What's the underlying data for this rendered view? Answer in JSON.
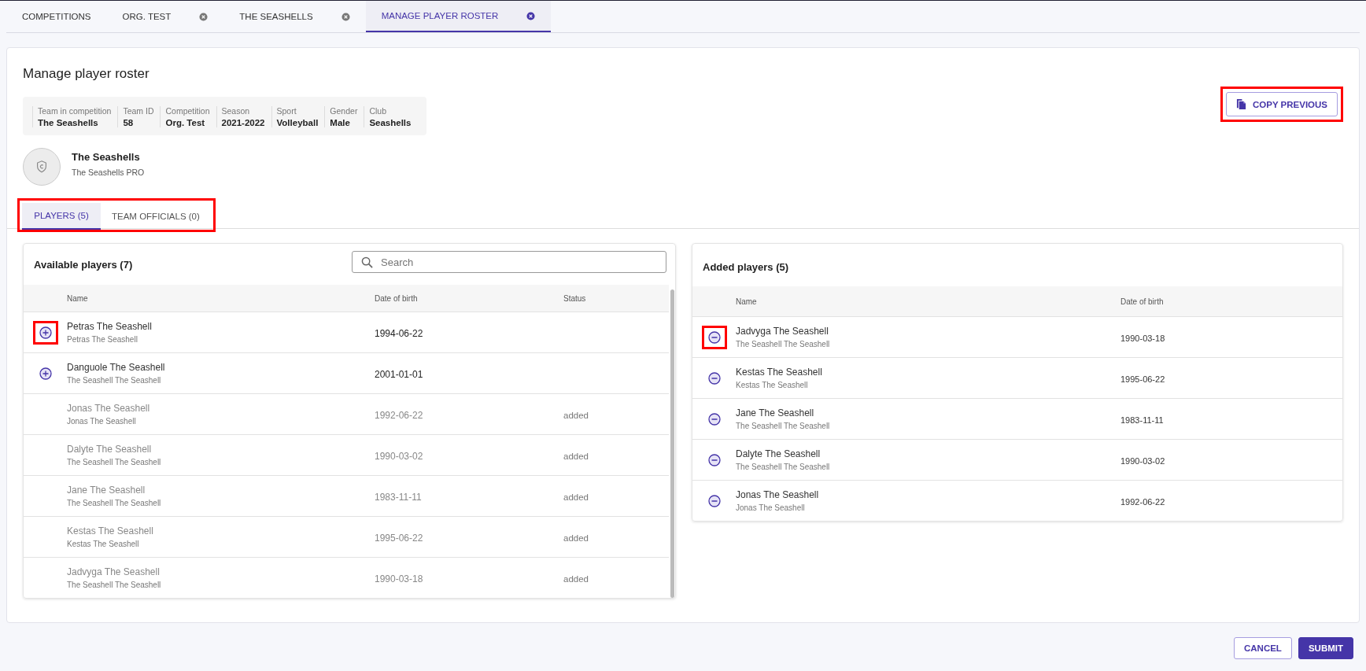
{
  "top_tabs": [
    {
      "label": "COMPETITIONS",
      "closable": false,
      "selected": false
    },
    {
      "label": "ORG. TEST",
      "closable": true,
      "selected": false
    },
    {
      "label": "THE SEASHELLS",
      "closable": true,
      "selected": false
    },
    {
      "label": "MANAGE PLAYER ROSTER",
      "closable": true,
      "selected": true
    }
  ],
  "page_title": "Manage player roster",
  "copy_button": {
    "label": "COPY PREVIOUS",
    "highlighted": true
  },
  "info": [
    {
      "label": "Team in competition",
      "value": "The Seashells"
    },
    {
      "label": "Team ID",
      "value": "58"
    },
    {
      "label": "Competition",
      "value": "Org. Test"
    },
    {
      "label": "Season",
      "value": "2021-2022"
    },
    {
      "label": "Sport",
      "value": "Volleyball"
    },
    {
      "label": "Gender",
      "value": "Male"
    },
    {
      "label": "Club",
      "value": "Seashells"
    }
  ],
  "team": {
    "name": "The Seashells",
    "subtitle": "The Seashells PRO"
  },
  "section_tabs": {
    "highlighted": true,
    "items": [
      {
        "label": "PLAYERS (5)",
        "selected": true
      },
      {
        "label": "TEAM OFFICIALS (0)",
        "selected": false
      }
    ]
  },
  "available": {
    "title": "Available players (7)",
    "search": {
      "placeholder": "Search"
    },
    "columns": [
      "Name",
      "Date of birth",
      "Status"
    ],
    "rows": [
      {
        "name": "Petras The Seashell",
        "sub": "Petras The Seashell",
        "dob": "1994-06-22",
        "added": false,
        "highlighted": true
      },
      {
        "name": "Danguole The Seashell",
        "sub": "The Seashell The Seashell",
        "dob": "2001-01-01",
        "added": false,
        "highlighted": false
      },
      {
        "name": "Jonas The Seashell",
        "sub": "Jonas The Seashell",
        "dob": "1992-06-22",
        "added": true,
        "status": "added",
        "highlighted": false
      },
      {
        "name": "Dalyte The Seashell",
        "sub": "The Seashell The Seashell",
        "dob": "1990-03-02",
        "added": true,
        "status": "added",
        "highlighted": false
      },
      {
        "name": "Jane The Seashell",
        "sub": "The Seashell The Seashell",
        "dob": "1983-11-11",
        "added": true,
        "status": "added",
        "highlighted": false
      },
      {
        "name": "Kestas The Seashell",
        "sub": "Kestas The Seashell",
        "dob": "1995-06-22",
        "added": true,
        "status": "added",
        "highlighted": false
      },
      {
        "name": "Jadvyga The Seashell",
        "sub": "The Seashell The Seashell",
        "dob": "1990-03-18",
        "added": true,
        "status": "added",
        "highlighted": false
      }
    ]
  },
  "added_players": {
    "title": "Added players (5)",
    "columns": [
      "Name",
      "Date of birth"
    ],
    "rows": [
      {
        "name": "Jadvyga The Seashell",
        "sub": "The Seashell The Seashell",
        "dob": "1990-03-18",
        "highlighted": true
      },
      {
        "name": "Kestas The Seashell",
        "sub": "Kestas The Seashell",
        "dob": "1995-06-22",
        "highlighted": false
      },
      {
        "name": "Jane The Seashell",
        "sub": "The Seashell The Seashell",
        "dob": "1983-11-11",
        "highlighted": false
      },
      {
        "name": "Dalyte The Seashell",
        "sub": "The Seashell The Seashell",
        "dob": "1990-03-02",
        "highlighted": false
      },
      {
        "name": "Jonas The Seashell",
        "sub": "Jonas The Seashell",
        "dob": "1992-06-22",
        "highlighted": false
      }
    ]
  },
  "footer_buttons": [
    {
      "label": "CANCEL",
      "kind": "secondary"
    },
    {
      "label": "SUBMIT",
      "kind": "primary"
    }
  ]
}
